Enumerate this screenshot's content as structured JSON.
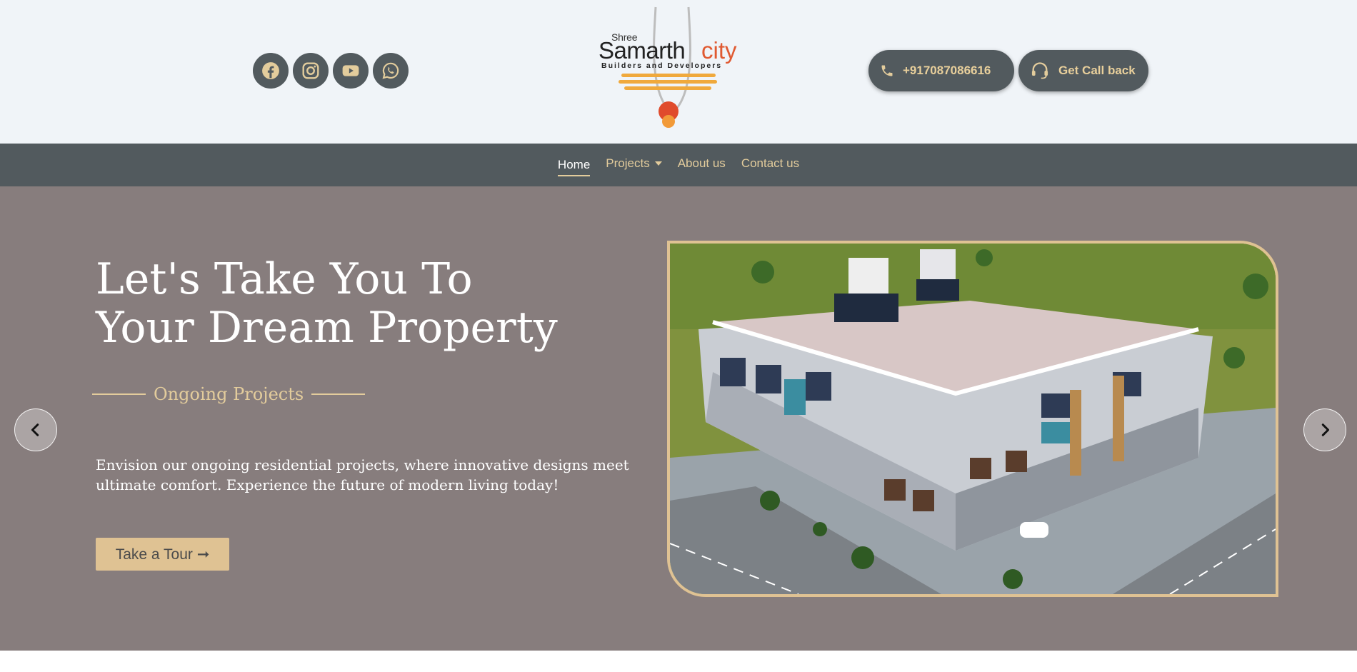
{
  "header": {
    "social_icons": [
      "facebook-icon",
      "instagram-icon",
      "youtube-icon",
      "whatsapp-icon"
    ],
    "logo": {
      "shree": "Shree",
      "name": "Samarth",
      "city": "city",
      "tagline": "Builders and Developers"
    },
    "phone": "+917087086616",
    "callback_label": "Get Call back"
  },
  "nav": {
    "items": [
      {
        "label": "Home",
        "active": true
      },
      {
        "label": "Projects",
        "dropdown": true
      },
      {
        "label": "About us"
      },
      {
        "label": "Contact us"
      }
    ]
  },
  "hero": {
    "title_line1": "Let's Take You To",
    "title_line2": "Your Dream Property",
    "subtitle": "Ongoing Projects",
    "description": "Envision our ongoing residential projects, where innovative designs meet ultimate comfort. Experience the future of modern living today!",
    "cta_label": "Take a Tour ➞"
  },
  "colors": {
    "accent": "#e3cc9c",
    "dark": "#525a5e",
    "hero_bg": "#877d7d",
    "header_bg": "#f0f4f8",
    "logo_red": "#e05a32"
  }
}
